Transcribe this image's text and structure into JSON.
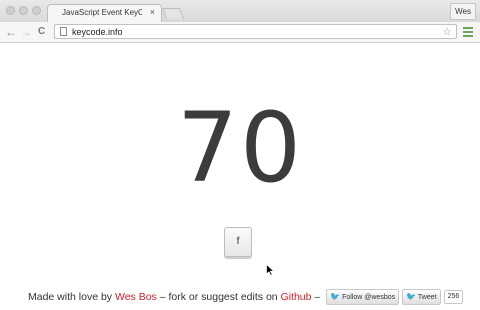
{
  "window": {
    "tab_title": "JavaScript Event KeyCod",
    "tab_close": "×",
    "profile_label": "Wes"
  },
  "toolbar": {
    "back_glyph": "←",
    "forward_glyph": "→",
    "reload_glyph": "C",
    "url": "keycode.info",
    "star_glyph": "☆"
  },
  "page": {
    "keycode": "70",
    "key_label": "f"
  },
  "footer": {
    "prefix": "Made with love by",
    "author": "Wes Bos",
    "middle": "– fork or suggest edits on",
    "github": "Github",
    "dash": "–",
    "follow_label": "Follow @wesbos",
    "tweet_label": "Tweet",
    "tweet_count": "256"
  },
  "colors": {
    "link_red": "#d0212b",
    "keycode_gray": "#3c3c3c",
    "twitter_blue": "#2b97d6",
    "menu_green": "#6aa84f"
  }
}
